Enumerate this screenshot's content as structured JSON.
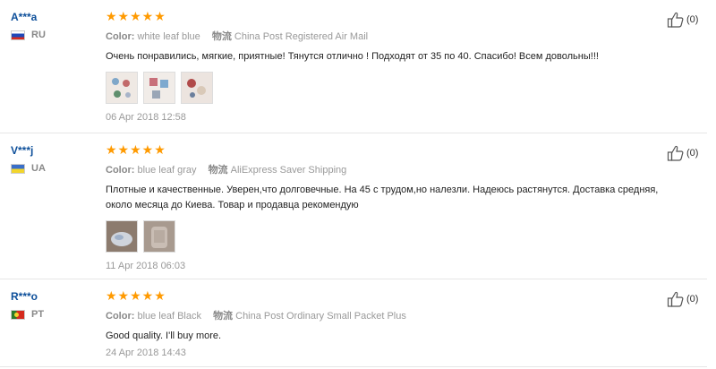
{
  "reviews": [
    {
      "username": "A***a",
      "country": "RU",
      "flag_icon": "russia-flag-icon",
      "rating": 5,
      "stars": "★★★★★",
      "color_label": "Color:",
      "color_value": "white leaf blue",
      "shipping_label": "物流",
      "shipping_value": "China Post Registered Air Mail",
      "text": "Очень понравились, мягкие, приятные! Тянутся отлично ! Подходят от 35 по 40. Спасибо! Всем довольны!!!",
      "photo_count": 3,
      "date": "06 Apr 2018 12:58",
      "helpful_count": "(0)"
    },
    {
      "username": "V***j",
      "country": "UA",
      "flag_icon": "ukraine-flag-icon",
      "rating": 5,
      "stars": "★★★★★",
      "color_label": "Color:",
      "color_value": "blue leaf gray",
      "shipping_label": "物流",
      "shipping_value": "AliExpress Saver Shipping",
      "text": "Плотные и качественные. Уверен,что долговечные. На 45 с трудом,но налезли. Надеюсь растянутся. Доставка средняя, около месяца до Киева. Товар и продавца рекомендую",
      "photo_count": 2,
      "date": "11 Apr 2018 06:03",
      "helpful_count": "(0)"
    },
    {
      "username": "R***o",
      "country": "PT",
      "flag_icon": "portugal-flag-icon",
      "rating": 5,
      "stars": "★★★★★",
      "color_label": "Color:",
      "color_value": "blue leaf Black",
      "shipping_label": "物流",
      "shipping_value": "China Post Ordinary Small Packet Plus",
      "text": "Good quality. I'll buy more.",
      "photo_count": 0,
      "date": "24 Apr 2018 14:43",
      "helpful_count": "(0)"
    }
  ],
  "colors": {
    "username": "#0d4f9a",
    "stars": "#ff9a00",
    "muted": "#999999"
  },
  "icons": {
    "helpful": "thumbs-up-icon"
  }
}
